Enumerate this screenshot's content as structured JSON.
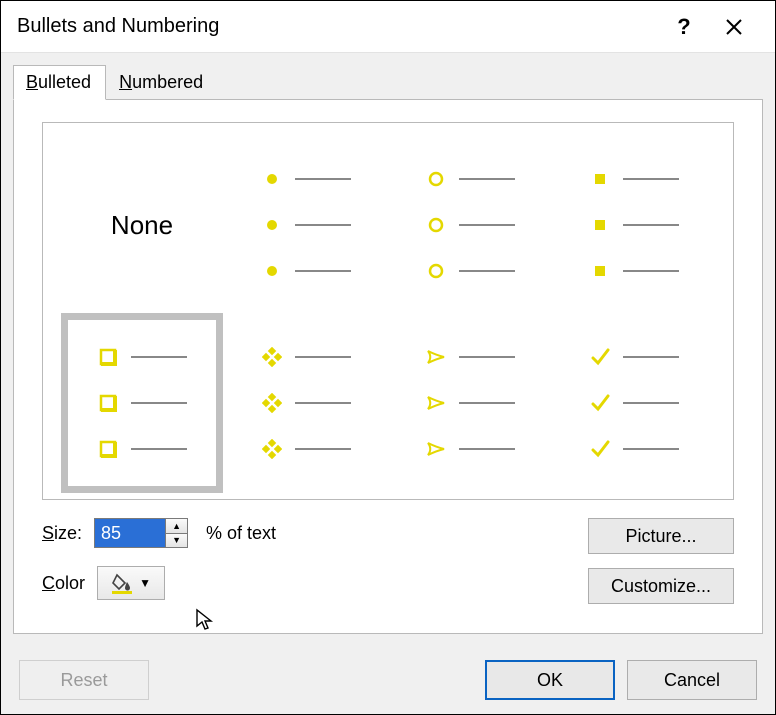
{
  "titlebar": {
    "title": "Bullets and Numbering",
    "help": "?",
    "close": "✕"
  },
  "tabs": {
    "bulleted": "Bulleted",
    "numbered": "Numbered",
    "active": "bulleted"
  },
  "gallery": {
    "none_label": "None",
    "selected_index": 4
  },
  "size": {
    "label": "Size:",
    "value": "85",
    "suffix": "% of text"
  },
  "color": {
    "label": "Color",
    "accent": "#e4d800"
  },
  "buttons": {
    "picture": "Picture...",
    "customize": "Customize...",
    "reset": "Reset",
    "ok": "OK",
    "cancel": "Cancel"
  }
}
